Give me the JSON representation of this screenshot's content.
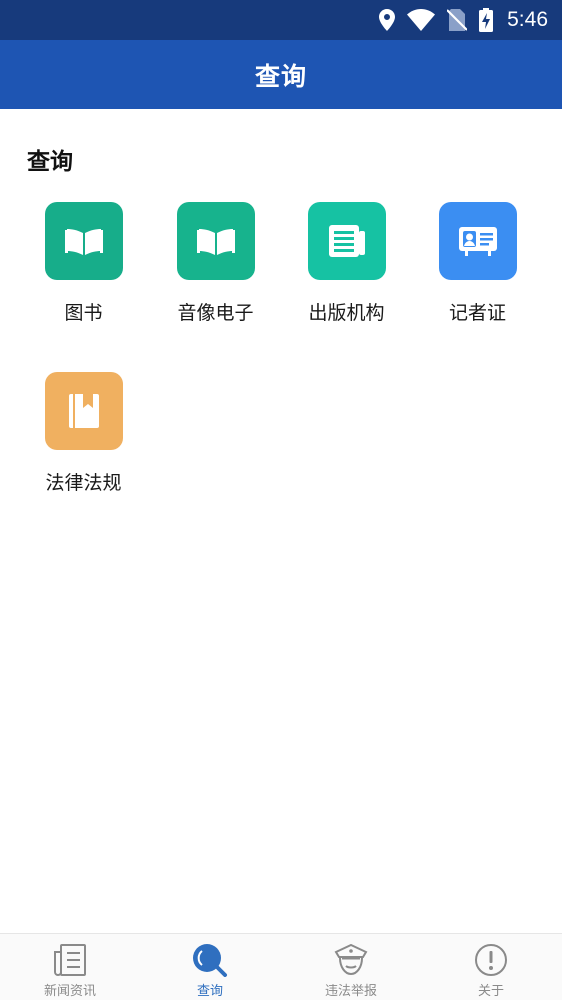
{
  "status_bar": {
    "time": "5:46"
  },
  "app_bar": {
    "title": "查询"
  },
  "section": {
    "title": "查询"
  },
  "grid": {
    "items": [
      {
        "label": "图书",
        "icon": "book-open-icon",
        "color": "#17ad8a"
      },
      {
        "label": "音像电子",
        "icon": "book-open-icon",
        "color": "#17b38d"
      },
      {
        "label": "出版机构",
        "icon": "newspaper-icon",
        "color": "#16c2a3"
      },
      {
        "label": "记者证",
        "icon": "id-card-icon",
        "color": "#3b8ef2"
      },
      {
        "label": "法律法规",
        "icon": "bookmark-book-icon",
        "color": "#f0b060"
      }
    ]
  },
  "bottom_nav": {
    "items": [
      {
        "label": "新闻资讯",
        "icon": "news-icon"
      },
      {
        "label": "查询",
        "icon": "search-icon",
        "active": true
      },
      {
        "label": "违法举报",
        "icon": "police-cap-icon"
      },
      {
        "label": "关于",
        "icon": "info-icon"
      }
    ],
    "active_color": "#2f6fbf",
    "inactive_color": "#8a8a8a"
  }
}
